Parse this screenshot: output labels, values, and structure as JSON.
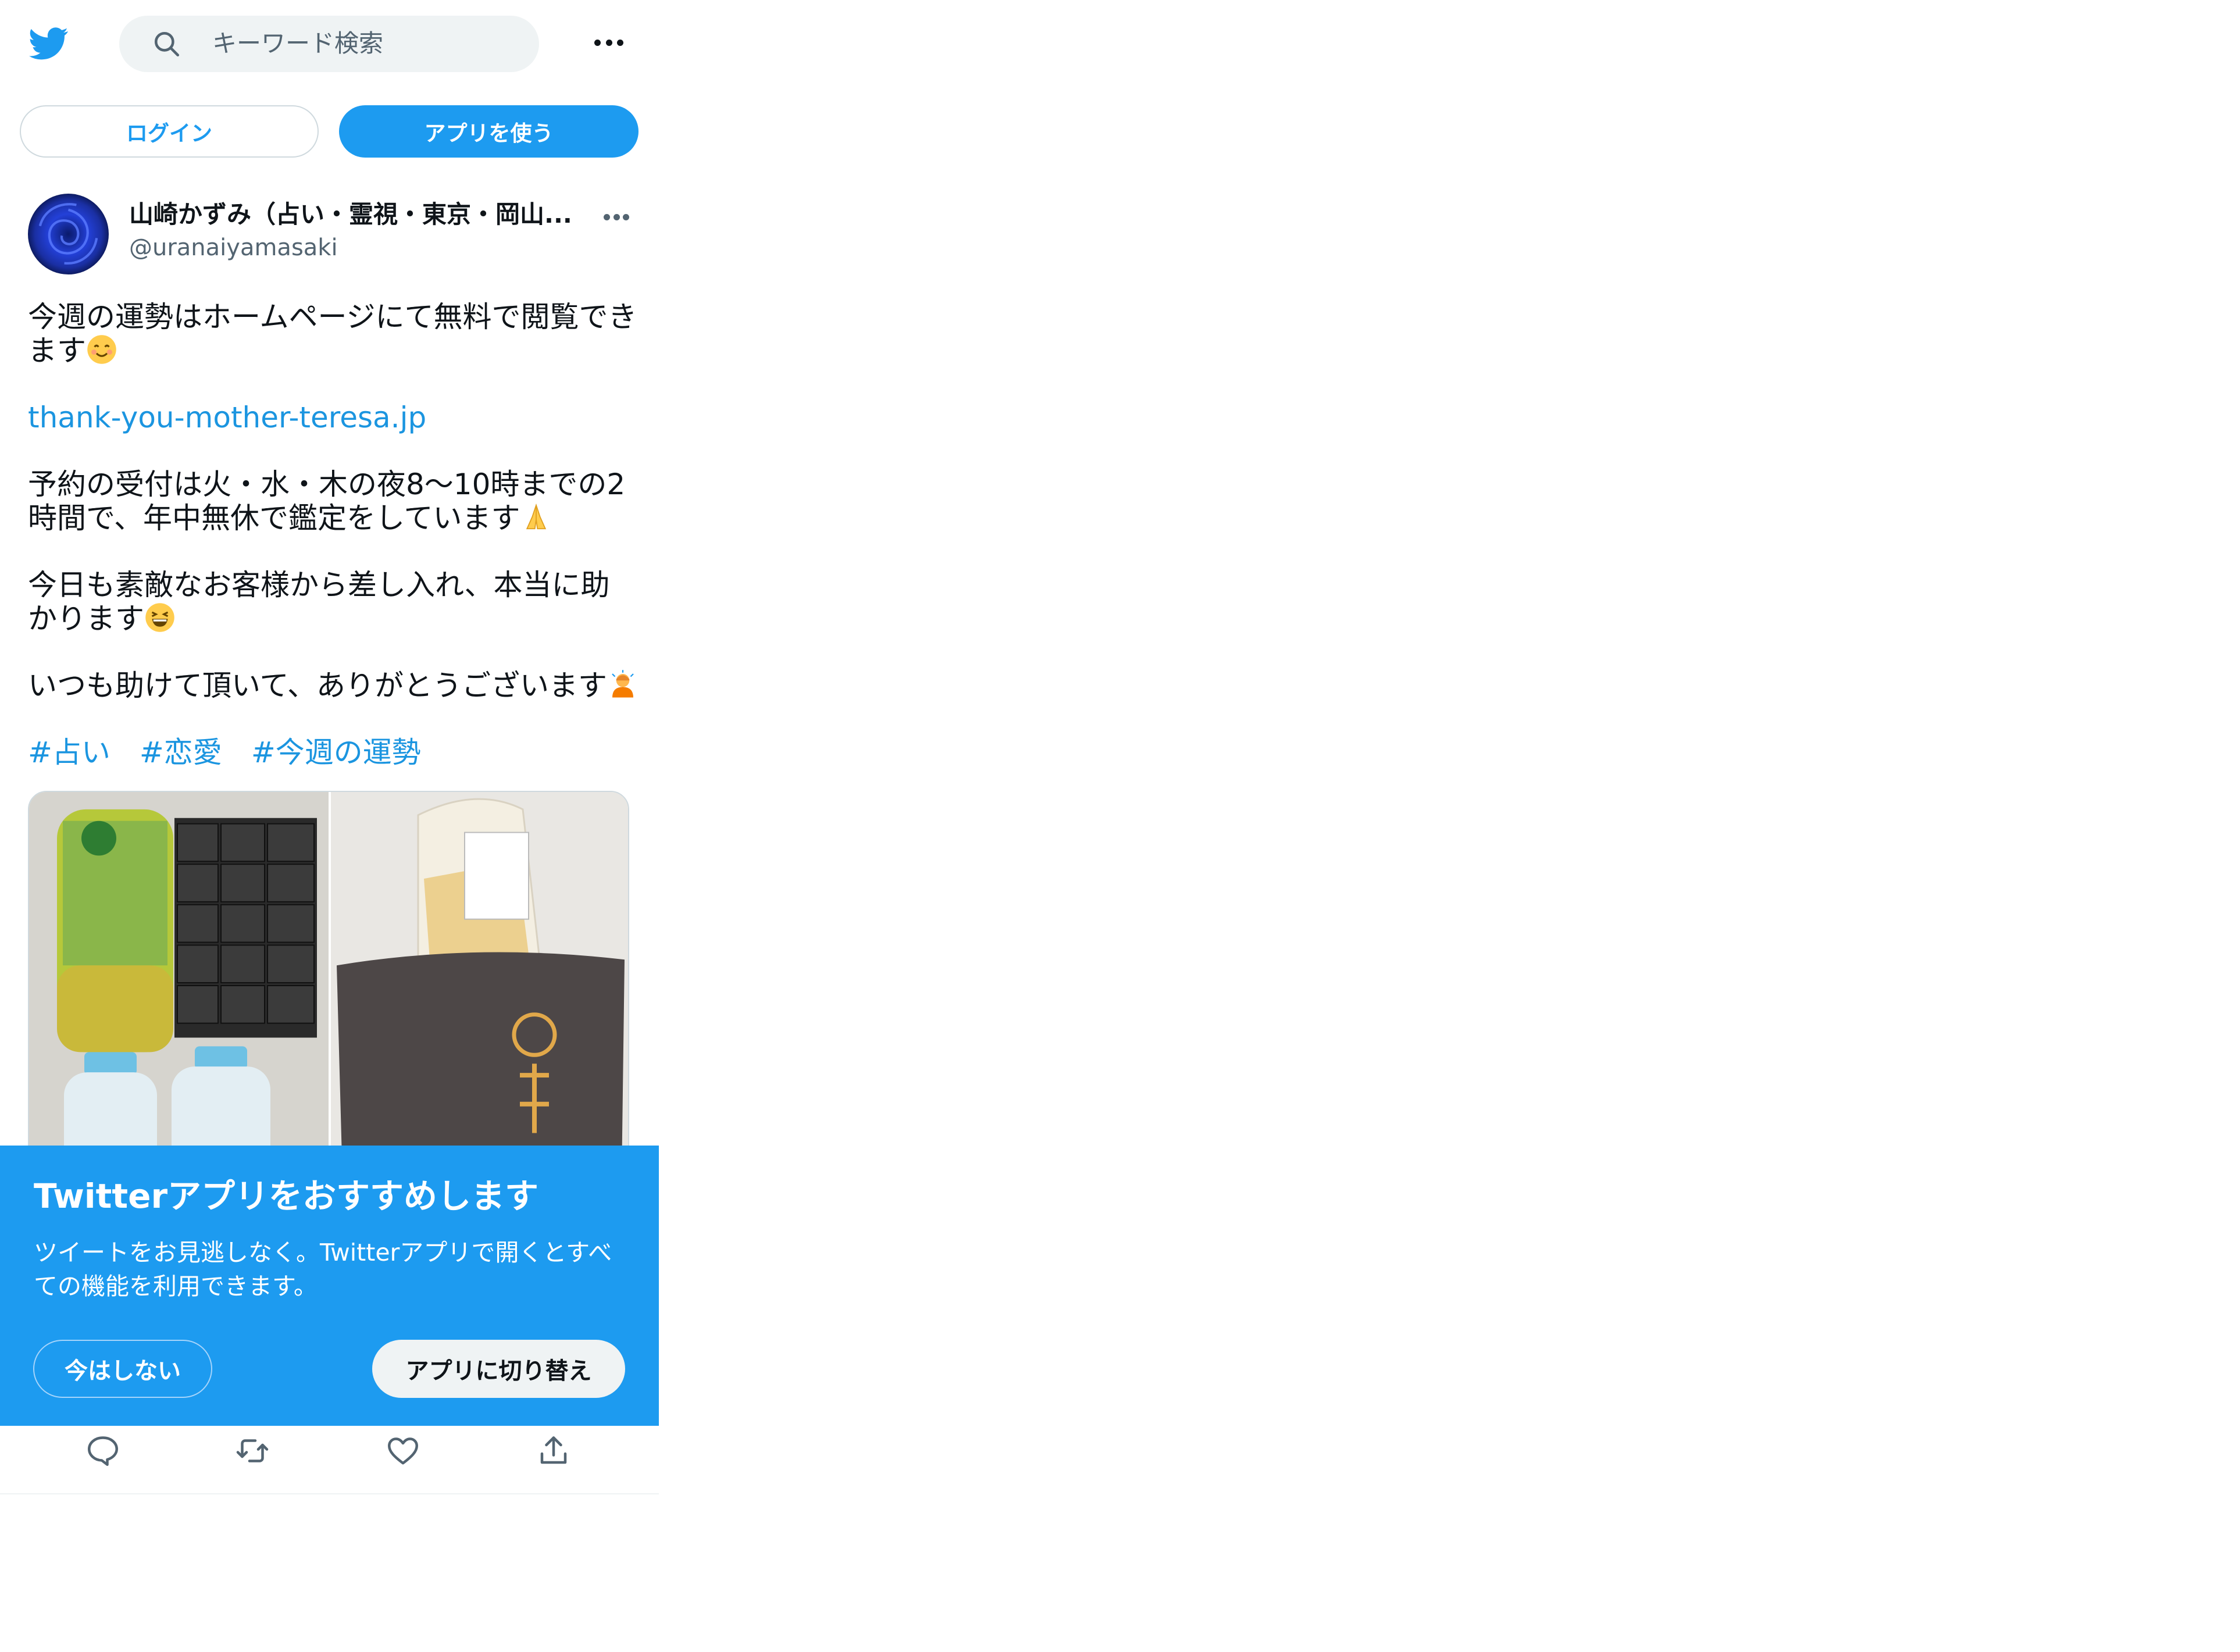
{
  "header": {
    "search_placeholder": "キーワード検索",
    "icons": [
      "twitter-logo-icon",
      "search-icon",
      "more-icon"
    ],
    "brand_color": "#1d9bf0"
  },
  "auth": {
    "login_label": "ログイン",
    "use_app_label": "アプリを使う"
  },
  "tweet": {
    "display_name": "山崎かずみ（占い・霊視・東京・岡山...",
    "handle": "@uranaiyamasaki",
    "paragraphs": {
      "p1": "今週の運勢はホームページにて無料で閲覧できます",
      "link": "thank-you-mother-teresa.jp",
      "p2": "予約の受付は火・水・木の夜8〜10時までの2時間で、年中無休で鑑定をしています",
      "p3": "今日も素敵なお客様から差し入れ、本当に助かります",
      "p4": "いつも助けて頂いて、ありがとうございます"
    },
    "hashtags": [
      "#占い",
      "#恋愛",
      "#今週の運勢"
    ]
  },
  "banner": {
    "title": "Twitterアプリをおすすめします",
    "description": "ツイートをお見逃しなく。Twitterアプリで開くとすべての機能を利用できます。",
    "not_now_label": "今はしない",
    "switch_label": "アプリに切り替え"
  },
  "actions": [
    "reply-icon",
    "retweet-icon",
    "like-icon",
    "share-icon"
  ]
}
